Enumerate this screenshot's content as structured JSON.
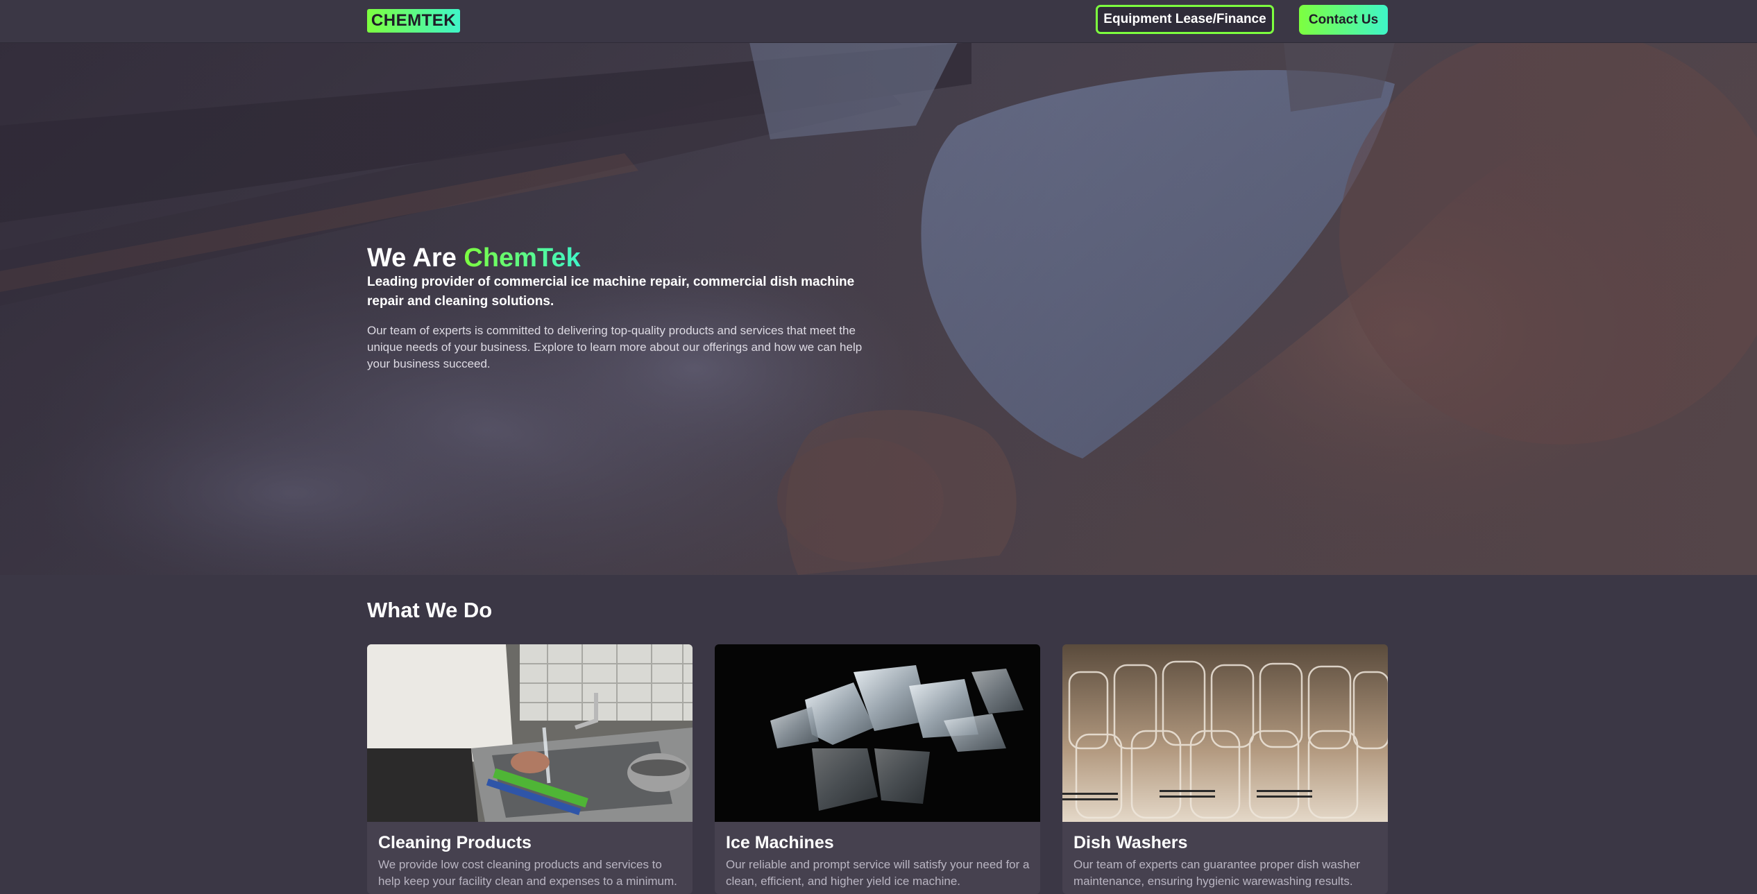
{
  "nav": {
    "logo": "CHEMTEK",
    "lease_button": "Equipment Lease/Finance",
    "contact_button": "Contact Us"
  },
  "hero": {
    "title_prefix": "We Are ",
    "title_brand": "ChemTek",
    "lead": "Leading provider of commercial ice machine repair, commercial dish machine repair and cleaning solutions.",
    "body": "Our team of experts is committed to delivering top-quality products and services that meet the unique needs of your business. Explore to learn more about our offerings and how we can help your business succeed."
  },
  "services": {
    "heading": "What We Do",
    "cards": [
      {
        "title": "Cleaning Products",
        "text": "We provide low cost cleaning products and services to help keep your facility clean and expenses to a minimum."
      },
      {
        "title": "Ice Machines",
        "text": "Our reliable and prompt service will satisfy your need for a clean, efficient, and higher yield ice machine."
      },
      {
        "title": "Dish Washers",
        "text": "Our team of experts can guarantee proper dish washer maintenance, ensuring hygienic warewashing results."
      }
    ]
  },
  "colors": {
    "background": "#3b3745",
    "accent_green": "#7dff3f",
    "accent_cyan": "#3ff5c8"
  }
}
